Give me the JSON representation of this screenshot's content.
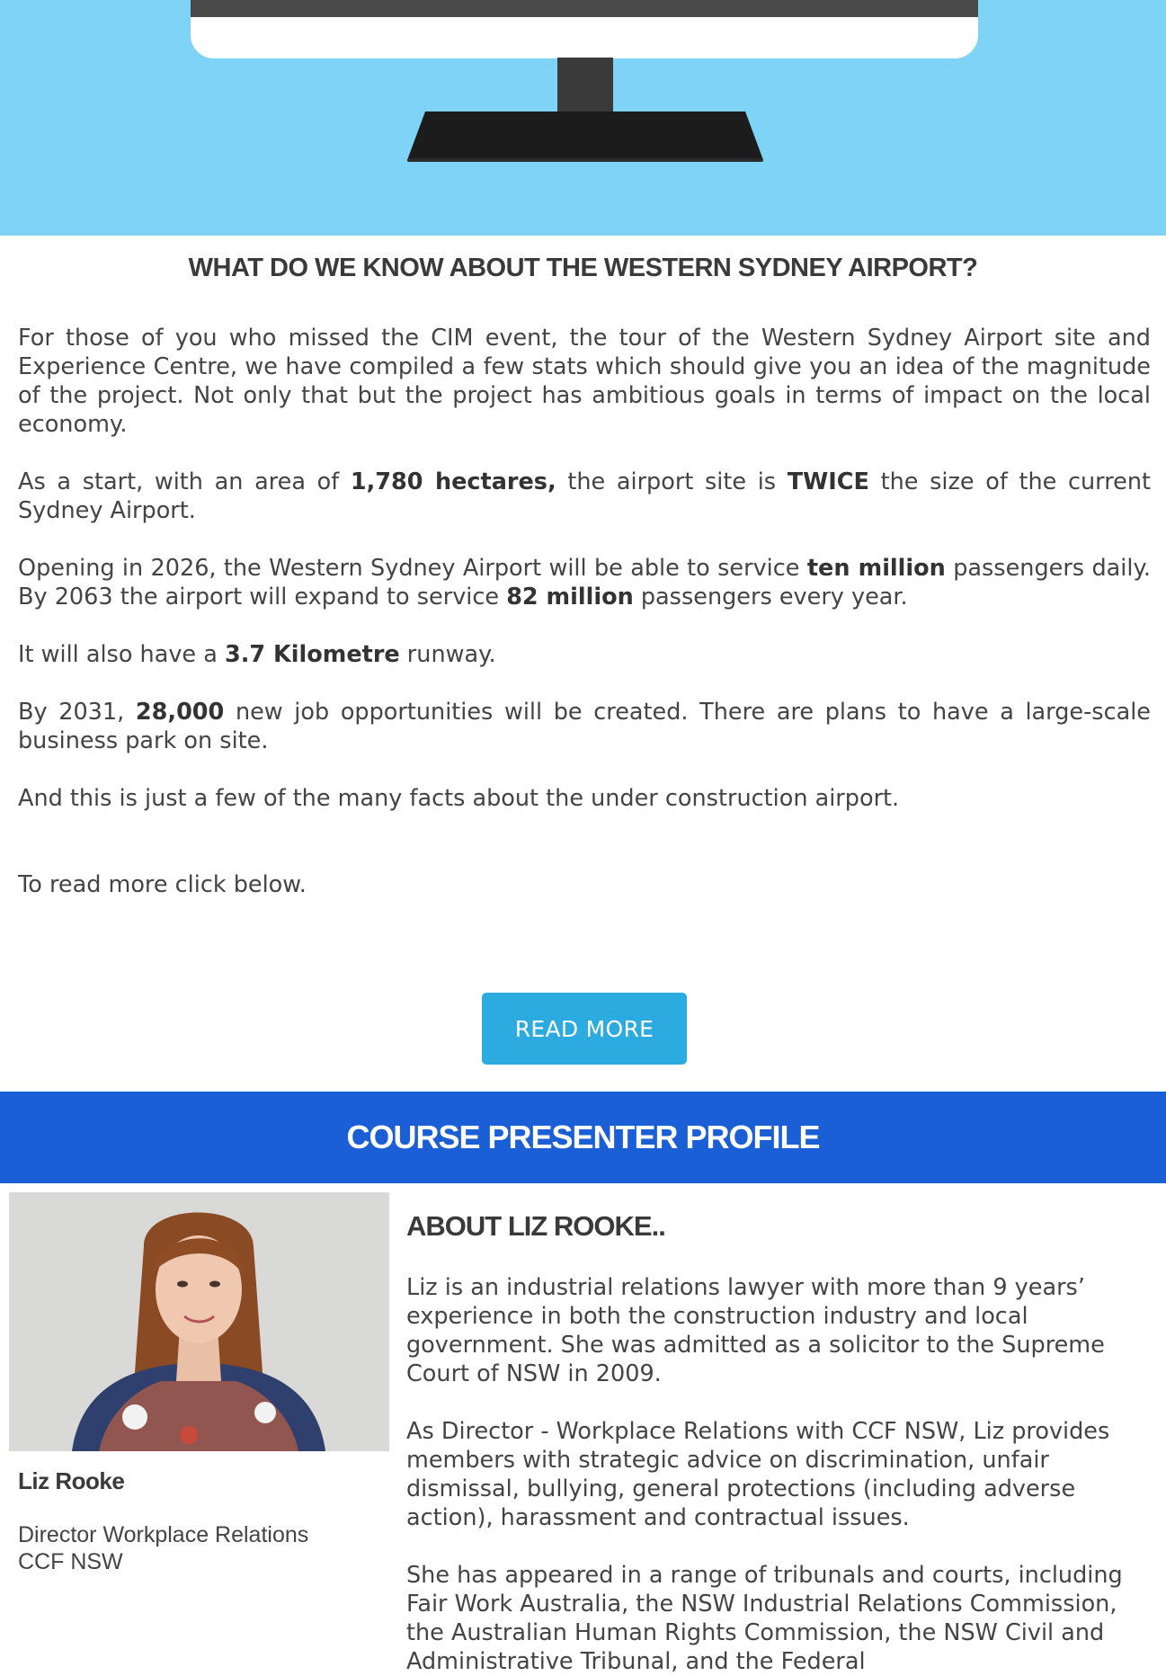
{
  "hero": {
    "illustration": "desktop-monitor-icon",
    "background_color": "#7fd3f6"
  },
  "article": {
    "title": "WHAT DO WE KNOW ABOUT THE WESTERN SYDNEY AIRPORT?",
    "p1": "For those of you who missed the CIM event, the tour of the Western Sydney Airport site and Experience Centre, we have compiled a few stats which should give you an idea of the magnitude of the project. Not only that but the project has ambitious goals in terms of impact on the local economy.",
    "p2": {
      "t1": "As a start, with an area of ",
      "b1": "1,780 hectares,",
      "t2": " the airport site is ",
      "b2": "TWICE",
      "t3": " the size of the current Sydney Airport."
    },
    "p3": {
      "t1": "Opening in 2026, the Western Sydney Airport will be able to service ",
      "b1": "ten million",
      "t2": " passengers daily. By 2063 the airport will expand to service ",
      "b2": "82 million",
      "t3": " passengers every year."
    },
    "p4": {
      "t1": "It will also have a ",
      "b1": "3.7 Kilometre",
      "t2": " runway."
    },
    "p5": {
      "t1": "By 2031, ",
      "b1": "28,000",
      "t2": " new job opportunities will be created. There are plans to have a large-scale business park on site."
    },
    "p6": "And this is just a few of the many facts about the under construction airport.",
    "p7": "To read more click below.",
    "read_more_label": "READ MORE",
    "button_color": "#2cabe0"
  },
  "presenter": {
    "section_title": "COURSE PRESENTER PROFILE",
    "bar_color": "#1a5fd6",
    "name": "Liz Rooke",
    "role_line1": "Director Workplace Relations",
    "role_line2": "CCF NSW",
    "about_title": "ABOUT LIZ ROOKE..",
    "bio1": "Liz is an industrial relations lawyer with more than 9 years’ experience in both the construction industry and local government. She was admitted as a solicitor to the Supreme Court of NSW in 2009.",
    "bio2": "As Director - Workplace Relations with CCF NSW, Liz provides members with strategic advice on discrimination, unfair dismissal, bullying, general protections (including adverse action), harassment and contractual issues.",
    "bio3": "She has appeared in a range of tribunals and courts, including Fair Work Australia, the NSW Industrial Relations Commission, the Australian Human Rights Commission, the NSW Civil and Administrative Tribunal, and the Federal"
  }
}
